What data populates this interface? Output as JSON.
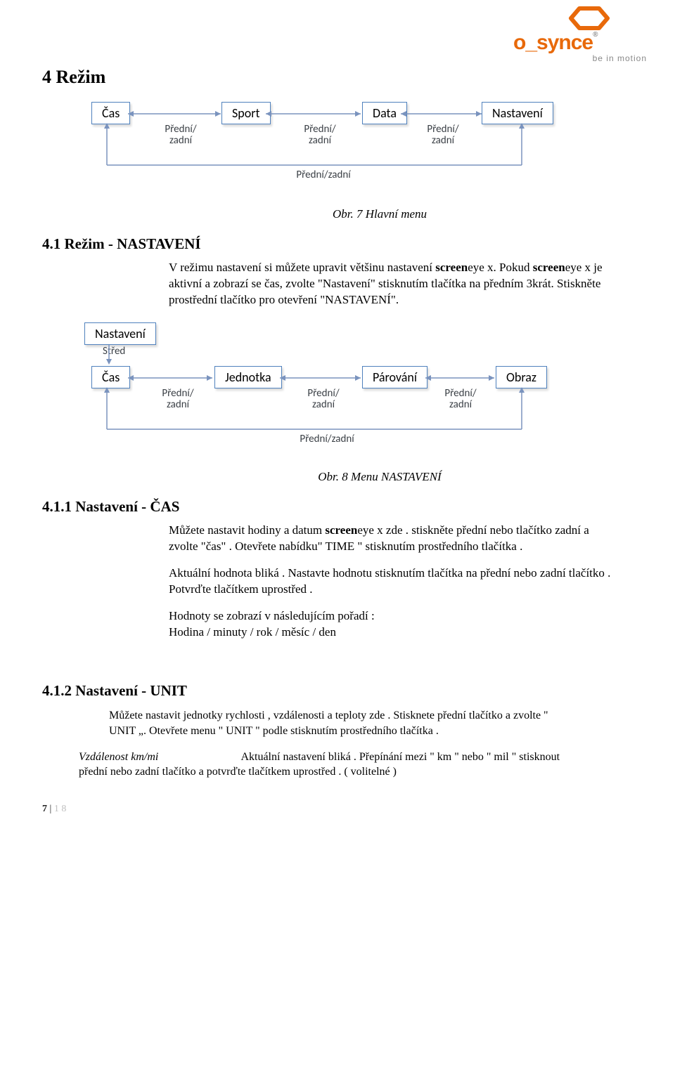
{
  "logo": {
    "brand": "o_synce",
    "tagline": "be in motion"
  },
  "h1": "4 Režim",
  "diagram1": {
    "boxes": [
      "Čas",
      "Sport",
      "Data",
      "Nastavení"
    ],
    "arrow_label": "Přední/\nzadní",
    "bottom_label": "Přední/zadní"
  },
  "caption1": "Obr. 7 Hlavní menu",
  "h2_1": "4.1 Režim - NASTAVENÍ",
  "para1_a": "V režimu nastavení si můžete upravit většinu nastavení ",
  "para1_bold1": "screen",
  "para1_b": "eye x. Pokud ",
  "para1_bold2": "screen",
  "para1_c": "eye x je aktivní a zobrazí se čas, zvolte \"Nastavení\" stisknutím tlačítka na předním 3krát. Stiskněte prostřední tlačítko pro otevření \"NASTAVENÍ\".",
  "diagram2": {
    "topbox": "Nastavení",
    "toplabel": "Střed",
    "boxes": [
      "Čas",
      "Jednotka",
      "Párování",
      "Obraz"
    ],
    "arrow_label": "Přední/\nzadní",
    "bottom_label": "Přední/zadní"
  },
  "caption2": "Obr. 8 Menu NASTAVENÍ",
  "h2_2": "4.1.1 Nastavení - ČAS",
  "para2_a": "Můžete nastavit hodiny a datum ",
  "para2_bold": "screen",
  "para2_b": "eye x zde . stiskněte přední nebo tlačítko zadní a zvolte \"čas\" . Otevřete nabídku\" TIME \" stisknutím prostředního tlačítka .",
  "para3": "Aktuální hodnota bliká . Nastavte hodnotu stisknutím tlačítka na přední nebo zadní tlačítko . Potvrďte tlačítkem uprostřed .",
  "para4": "Hodnoty se zobrazí v následujícím pořadí :\nHodina / minuty / rok / měsíc / den",
  "h2_3": "4.1.2 Nastavení - UNIT",
  "para5": "Můžete nastavit jednotky rychlosti , vzdálenosti a teploty zde . Stisknete přední tlačítko a zvolte \" UNIT „. Otevřete menu \" UNIT \" podle stisknutím prostředního tlačítka .",
  "para6_label": "Vzdálenost km/mi",
  "para6_text": "Aktuální nastavení bliká . Přepínání mezi \" km \" nebo \"  mil \" stisknout přední nebo zadní tlačítko a potvrďte tlačítkem uprostřed . ( volitelné )",
  "footer_page": "7",
  "footer_sep": " | ",
  "footer_total": "1 8"
}
